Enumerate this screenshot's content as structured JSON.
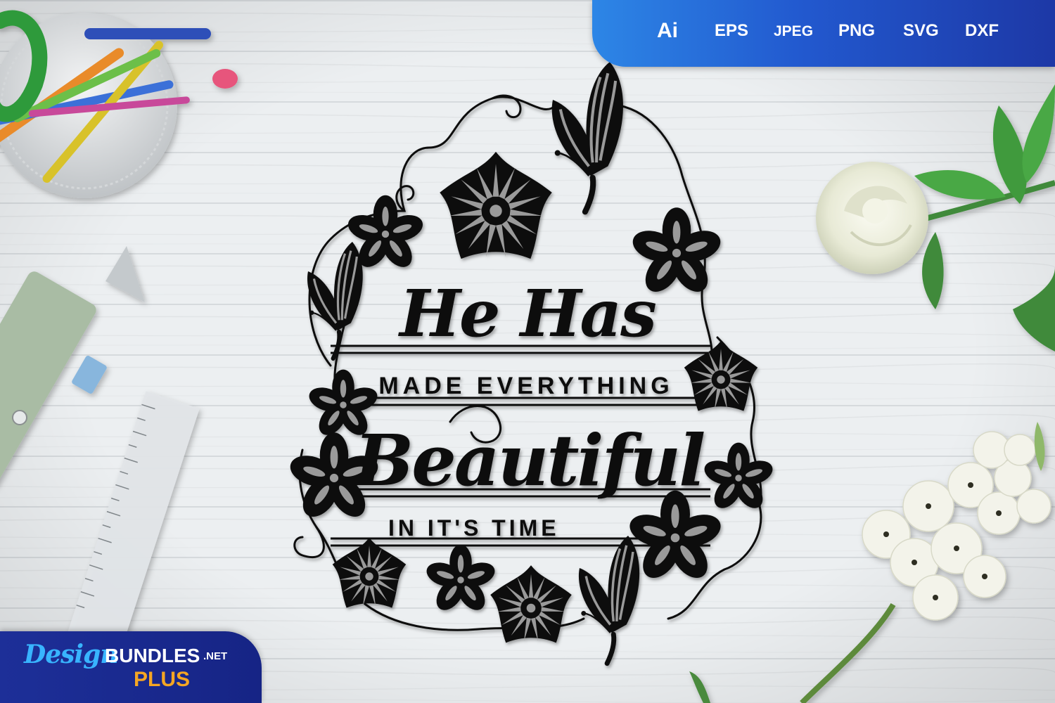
{
  "formats": [
    "Ai",
    "EPS",
    "JPEG",
    "PNG",
    "SVG",
    "DXF"
  ],
  "artwork": {
    "line1": "He Has",
    "line2": "MADE EVERYTHING",
    "line3": "Beautiful",
    "line4": "IN IT'S TIME"
  },
  "brand": {
    "design": "Design",
    "bundles": "BUNDLES",
    "net": ".NET",
    "plus": "PLUS"
  },
  "colors": {
    "banner_start": "#2d86e6",
    "banner_end": "#1d38a6",
    "brand_blue": "#38b4ff",
    "brand_plus": "#f5a623",
    "artwork_ink": "#111111",
    "petal_gray": "#9a9a9a"
  },
  "icons": [
    "pencil-cup-icon",
    "utility-knife-icon",
    "ruler-icon",
    "white-rose-icon",
    "white-blossom-icon",
    "butterfly-icon",
    "flower-icon"
  ]
}
